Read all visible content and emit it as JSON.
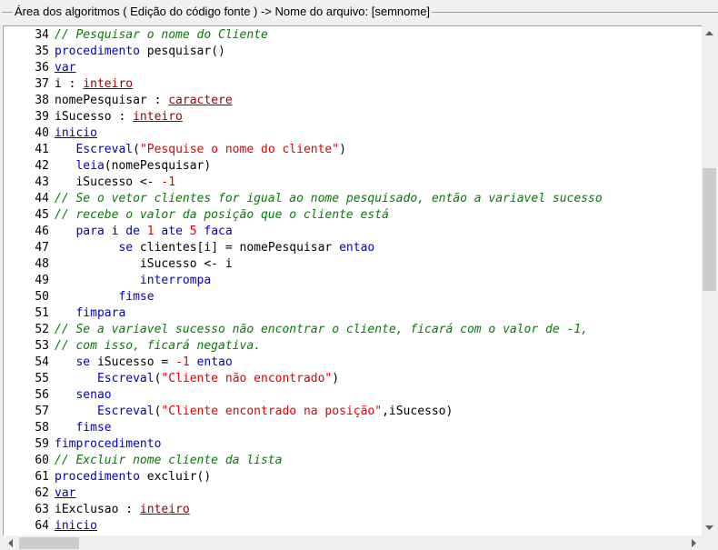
{
  "panel": {
    "title": "Área dos algoritmos ( Edição do código fonte ) -> Nome do arquivo: [semnome]"
  },
  "code": {
    "lines": [
      {
        "n": "34",
        "tokens": [
          {
            "t": "// Pesquisar o nome do Cliente",
            "c": "c"
          }
        ]
      },
      {
        "n": "35",
        "tokens": [
          {
            "t": "procedimento",
            "c": "k"
          },
          {
            "t": " pesquisar()",
            "c": ""
          }
        ]
      },
      {
        "n": "36",
        "tokens": [
          {
            "t": "var",
            "c": "u"
          }
        ]
      },
      {
        "n": "37",
        "tokens": [
          {
            "t": "i : ",
            "c": ""
          },
          {
            "t": "inteiro",
            "c": "t"
          }
        ]
      },
      {
        "n": "38",
        "tokens": [
          {
            "t": "nomePesquisar : ",
            "c": ""
          },
          {
            "t": "caractere",
            "c": "t"
          }
        ]
      },
      {
        "n": "39",
        "tokens": [
          {
            "t": "iSucesso : ",
            "c": ""
          },
          {
            "t": "inteiro",
            "c": "t"
          }
        ]
      },
      {
        "n": "40",
        "tokens": [
          {
            "t": "inicio",
            "c": "u"
          }
        ]
      },
      {
        "n": "41",
        "tokens": [
          {
            "t": "   ",
            "c": ""
          },
          {
            "t": "Escreval",
            "c": "k"
          },
          {
            "t": "(",
            "c": ""
          },
          {
            "t": "\"Pesquise o nome do cliente\"",
            "c": "s"
          },
          {
            "t": ")",
            "c": ""
          }
        ]
      },
      {
        "n": "42",
        "tokens": [
          {
            "t": "   ",
            "c": ""
          },
          {
            "t": "leia",
            "c": "k"
          },
          {
            "t": "(nomePesquisar)",
            "c": ""
          }
        ]
      },
      {
        "n": "43",
        "tokens": [
          {
            "t": "   iSucesso <- ",
            "c": ""
          },
          {
            "t": "-1",
            "c": "n"
          }
        ]
      },
      {
        "n": "44",
        "tokens": [
          {
            "t": "// Se o vetor clientes for igual ao nome pesquisado, então a variavel sucesso",
            "c": "c"
          }
        ]
      },
      {
        "n": "45",
        "tokens": [
          {
            "t": "// recebe o valor da posição que o cliente está",
            "c": "c"
          }
        ]
      },
      {
        "n": "46",
        "tokens": [
          {
            "t": "   ",
            "c": ""
          },
          {
            "t": "para",
            "c": "k"
          },
          {
            "t": " i ",
            "c": ""
          },
          {
            "t": "de",
            "c": "k"
          },
          {
            "t": " ",
            "c": ""
          },
          {
            "t": "1",
            "c": "n"
          },
          {
            "t": " ",
            "c": ""
          },
          {
            "t": "ate",
            "c": "k"
          },
          {
            "t": " ",
            "c": ""
          },
          {
            "t": "5",
            "c": "n"
          },
          {
            "t": " ",
            "c": ""
          },
          {
            "t": "faca",
            "c": "k"
          }
        ]
      },
      {
        "n": "47",
        "tokens": [
          {
            "t": "         ",
            "c": ""
          },
          {
            "t": "se",
            "c": "k"
          },
          {
            "t": " clientes[i] = nomePesquisar ",
            "c": ""
          },
          {
            "t": "entao",
            "c": "k"
          }
        ]
      },
      {
        "n": "48",
        "tokens": [
          {
            "t": "            iSucesso <- i",
            "c": ""
          }
        ]
      },
      {
        "n": "49",
        "tokens": [
          {
            "t": "            ",
            "c": ""
          },
          {
            "t": "interrompa",
            "c": "k"
          }
        ]
      },
      {
        "n": "50",
        "tokens": [
          {
            "t": "         ",
            "c": ""
          },
          {
            "t": "fimse",
            "c": "k"
          }
        ]
      },
      {
        "n": "51",
        "tokens": [
          {
            "t": "   ",
            "c": ""
          },
          {
            "t": "fimpara",
            "c": "k"
          }
        ]
      },
      {
        "n": "52",
        "tokens": [
          {
            "t": "// Se a variavel sucesso não encontrar o cliente, ficará com o valor de -1,",
            "c": "c"
          }
        ]
      },
      {
        "n": "53",
        "tokens": [
          {
            "t": "// com isso, ficará negativa.",
            "c": "c"
          }
        ]
      },
      {
        "n": "54",
        "tokens": [
          {
            "t": "   ",
            "c": ""
          },
          {
            "t": "se",
            "c": "k"
          },
          {
            "t": " iSucesso = ",
            "c": ""
          },
          {
            "t": "-1",
            "c": "n"
          },
          {
            "t": " ",
            "c": ""
          },
          {
            "t": "entao",
            "c": "k"
          }
        ]
      },
      {
        "n": "55",
        "tokens": [
          {
            "t": "      ",
            "c": ""
          },
          {
            "t": "Escreval",
            "c": "k"
          },
          {
            "t": "(",
            "c": ""
          },
          {
            "t": "\"Cliente não encontrado\"",
            "c": "s"
          },
          {
            "t": ")",
            "c": ""
          }
        ]
      },
      {
        "n": "56",
        "tokens": [
          {
            "t": "   ",
            "c": ""
          },
          {
            "t": "senao",
            "c": "k"
          }
        ]
      },
      {
        "n": "57",
        "tokens": [
          {
            "t": "      ",
            "c": ""
          },
          {
            "t": "Escreval",
            "c": "k"
          },
          {
            "t": "(",
            "c": ""
          },
          {
            "t": "\"Cliente encontrado na posição\"",
            "c": "s"
          },
          {
            "t": ",iSucesso)",
            "c": ""
          }
        ]
      },
      {
        "n": "58",
        "tokens": [
          {
            "t": "   ",
            "c": ""
          },
          {
            "t": "fimse",
            "c": "k"
          }
        ]
      },
      {
        "n": "59",
        "tokens": [
          {
            "t": "fimprocedimento",
            "c": "k"
          }
        ]
      },
      {
        "n": "60",
        "tokens": [
          {
            "t": "// Excluir nome cliente da lista",
            "c": "c"
          }
        ]
      },
      {
        "n": "61",
        "tokens": [
          {
            "t": "procedimento",
            "c": "k"
          },
          {
            "t": " excluir()",
            "c": ""
          }
        ]
      },
      {
        "n": "62",
        "tokens": [
          {
            "t": "var",
            "c": "u"
          }
        ]
      },
      {
        "n": "63",
        "tokens": [
          {
            "t": "iExclusao : ",
            "c": ""
          },
          {
            "t": "inteiro",
            "c": "t"
          }
        ]
      },
      {
        "n": "64",
        "tokens": [
          {
            "t": "inicio",
            "c": "u"
          }
        ]
      }
    ]
  },
  "scrollbars": {
    "up_icon": "scroll-up-arrow",
    "down_icon": "scroll-down-arrow",
    "left_icon": "scroll-left-arrow",
    "right_icon": "scroll-right-arrow"
  }
}
